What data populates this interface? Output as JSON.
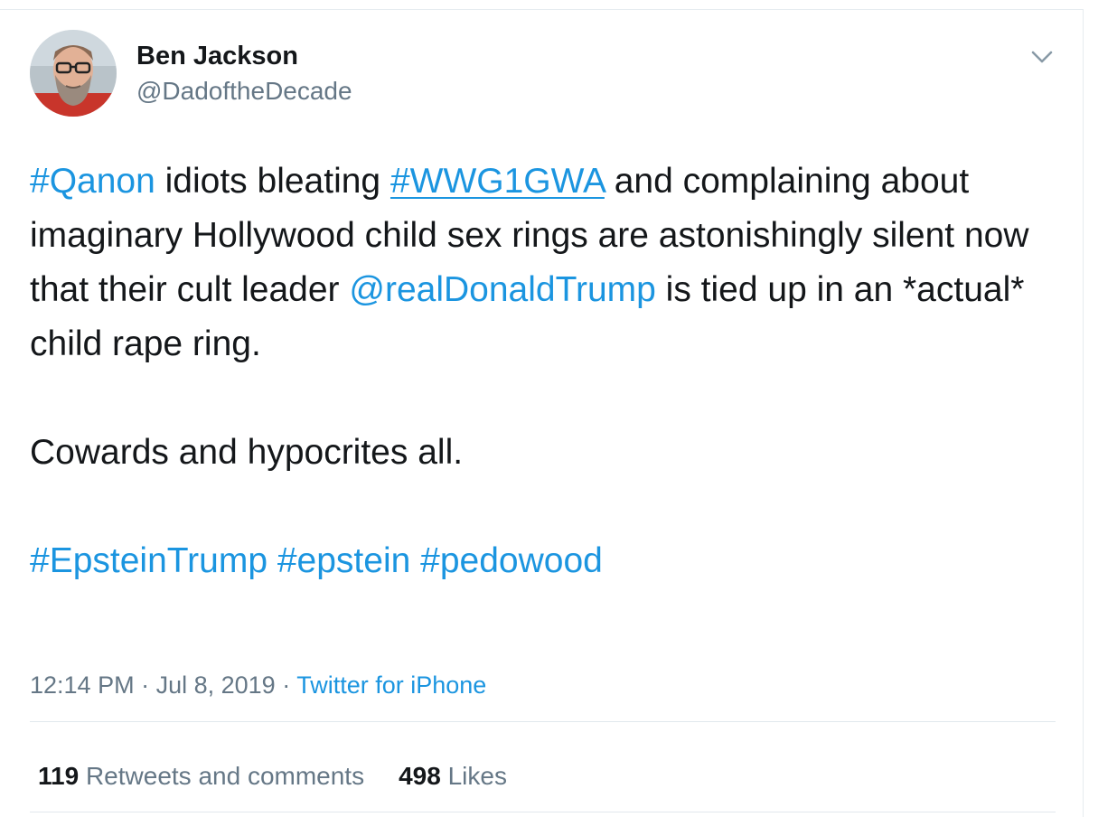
{
  "tweet": {
    "author": {
      "name": "Ben Jackson",
      "handle": "@DadoftheDecade"
    },
    "caret_icon": "chevron-down-icon",
    "body": {
      "line1_hashtag1": "#Qanon",
      "line1_text1": " idiots bleating ",
      "line1_hashtag2": "#WWG1GWA",
      "line1_text2": " and complaining about imaginary Hollywood child sex rings are astonishingly silent now that their cult leader ",
      "mention": "@realDonaldTrump",
      "line1_text3": " is tied up in an *actual* child rape ring.",
      "paragraph2": "Cowards and hypocrites all.",
      "hashtags": [
        "#EpsteinTrump",
        "#epstein",
        "#pedowood"
      ]
    },
    "meta": {
      "time": "12:14 PM",
      "separator1": " · ",
      "date": "Jul 8, 2019",
      "separator2": " · ",
      "source": "Twitter for iPhone"
    },
    "stats": {
      "retweets_count": "119",
      "retweets_label": "Retweets and comments",
      "likes_count": "498",
      "likes_label": "Likes"
    }
  },
  "colors": {
    "link": "#1b95e0",
    "text": "#14171a",
    "muted": "#657786",
    "divider": "#e1e8ed"
  }
}
